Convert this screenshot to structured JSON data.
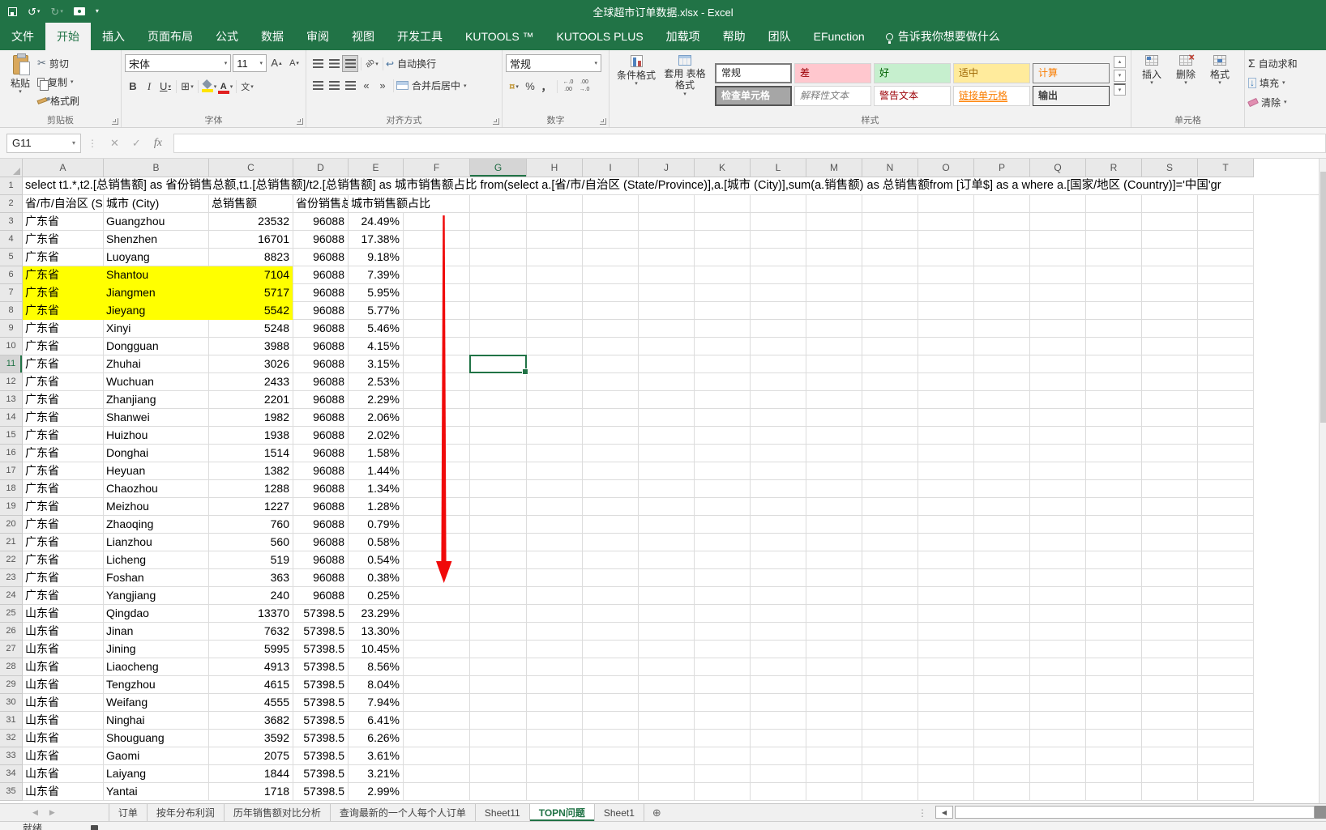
{
  "titlebar": {
    "title": "全球超市订单数据.xlsx  -  Excel"
  },
  "quick_access_icons": {
    "save": "floppy",
    "undo": "↺",
    "redo": "↻",
    "camera": "camera",
    "customize": "▾"
  },
  "ribbon_tabs": [
    {
      "label": "文件"
    },
    {
      "label": "开始",
      "active": true
    },
    {
      "label": "插入"
    },
    {
      "label": "页面布局"
    },
    {
      "label": "公式"
    },
    {
      "label": "数据"
    },
    {
      "label": "审阅"
    },
    {
      "label": "视图"
    },
    {
      "label": "开发工具"
    },
    {
      "label": "KUTOOLS ™"
    },
    {
      "label": "KUTOOLS PLUS"
    },
    {
      "label": "加载项"
    },
    {
      "label": "帮助"
    },
    {
      "label": "团队"
    },
    {
      "label": "EFunction"
    }
  ],
  "tell_me": "告诉我你想要做什么",
  "ribbon": {
    "clipboard": {
      "group": "剪贴板",
      "paste": "粘贴",
      "cut": "剪切",
      "copy": "复制",
      "format_painter": "格式刷"
    },
    "font": {
      "group": "字体",
      "family": "宋体",
      "size": "11",
      "bold": "B",
      "italic": "I",
      "underline": "U",
      "phonetic": "文"
    },
    "alignment": {
      "group": "对齐方式",
      "wrap_text": "自动换行",
      "merge_center": "合并后居中"
    },
    "number": {
      "group": "数字",
      "format": "常规",
      "percent": "%",
      "comma": "，"
    },
    "styles": {
      "group": "样式",
      "conditional_formatting": "条件格式",
      "format_as_table": "套用 表格格式",
      "cell_styles": [
        "常规",
        "差",
        "好",
        "适中",
        "计算",
        "检查单元格",
        "解释性文本",
        "警告文本",
        "链接单元格",
        "输出"
      ]
    },
    "cells": {
      "group": "单元格",
      "insert": "插入",
      "delete": "删除",
      "format": "格式"
    },
    "editing": {
      "autosum": "自动求和",
      "fill": "填充",
      "clear": "清除"
    }
  },
  "formula_bar": {
    "name_box": "G11",
    "fx": "fx"
  },
  "grid": {
    "columns": [
      "A",
      "B",
      "C",
      "D",
      "E",
      "F",
      "G",
      "H",
      "I",
      "J",
      "K",
      "L",
      "M",
      "N",
      "O",
      "P",
      "Q",
      "R",
      "S",
      "T"
    ],
    "selected": {
      "cell": "G11",
      "column": "G",
      "row": 11
    },
    "row1_text": "select t1.*,t2.[总销售额] as 省份销售总额,t1.[总销售额]/t2.[总销售额] as 城市销售额占比 from(select a.[省/市/自治区 (State/Province)],a.[城市 (City)],sum(a.销售额)  as 总销售额from [订单$] as a where  a.[国家/地区 (Country)]='中国'gr",
    "header_row": {
      "province": "省/市/自治区 (S",
      "city": "城市 (City)",
      "total": "总销售额",
      "province_total": "省份销售总",
      "share": "城市销售额占比"
    },
    "rows": [
      {
        "n": 3,
        "province": "广东省",
        "city": "Guangzhou",
        "total": "23532",
        "province_total": "96088",
        "share": "24.49%",
        "highlight": false
      },
      {
        "n": 4,
        "province": "广东省",
        "city": "Shenzhen",
        "total": "16701",
        "province_total": "96088",
        "share": "17.38%",
        "highlight": false
      },
      {
        "n": 5,
        "province": "广东省",
        "city": "Luoyang",
        "total": "8823",
        "province_total": "96088",
        "share": "9.18%",
        "highlight": false
      },
      {
        "n": 6,
        "province": "广东省",
        "city": "Shantou",
        "total": "7104",
        "province_total": "96088",
        "share": "7.39%",
        "highlight": true
      },
      {
        "n": 7,
        "province": "广东省",
        "city": "Jiangmen",
        "total": "5717",
        "province_total": "96088",
        "share": "5.95%",
        "highlight": true
      },
      {
        "n": 8,
        "province": "广东省",
        "city": "Jieyang",
        "total": "5542",
        "province_total": "96088",
        "share": "5.77%",
        "highlight": true
      },
      {
        "n": 9,
        "province": "广东省",
        "city": "Xinyi",
        "total": "5248",
        "province_total": "96088",
        "share": "5.46%",
        "highlight": false
      },
      {
        "n": 10,
        "province": "广东省",
        "city": "Dongguan",
        "total": "3988",
        "province_total": "96088",
        "share": "4.15%",
        "highlight": false
      },
      {
        "n": 11,
        "province": "广东省",
        "city": "Zhuhai",
        "total": "3026",
        "province_total": "96088",
        "share": "3.15%",
        "highlight": false
      },
      {
        "n": 12,
        "province": "广东省",
        "city": "Wuchuan",
        "total": "2433",
        "province_total": "96088",
        "share": "2.53%",
        "highlight": false
      },
      {
        "n": 13,
        "province": "广东省",
        "city": "Zhanjiang",
        "total": "2201",
        "province_total": "96088",
        "share": "2.29%",
        "highlight": false
      },
      {
        "n": 14,
        "province": "广东省",
        "city": "Shanwei",
        "total": "1982",
        "province_total": "96088",
        "share": "2.06%",
        "highlight": false
      },
      {
        "n": 15,
        "province": "广东省",
        "city": "Huizhou",
        "total": "1938",
        "province_total": "96088",
        "share": "2.02%",
        "highlight": false
      },
      {
        "n": 16,
        "province": "广东省",
        "city": "Donghai",
        "total": "1514",
        "province_total": "96088",
        "share": "1.58%",
        "highlight": false
      },
      {
        "n": 17,
        "province": "广东省",
        "city": "Heyuan",
        "total": "1382",
        "province_total": "96088",
        "share": "1.44%",
        "highlight": false
      },
      {
        "n": 18,
        "province": "广东省",
        "city": "Chaozhou",
        "total": "1288",
        "province_total": "96088",
        "share": "1.34%",
        "highlight": false
      },
      {
        "n": 19,
        "province": "广东省",
        "city": "Meizhou",
        "total": "1227",
        "province_total": "96088",
        "share": "1.28%",
        "highlight": false
      },
      {
        "n": 20,
        "province": "广东省",
        "city": "Zhaoqing",
        "total": "760",
        "province_total": "96088",
        "share": "0.79%",
        "highlight": false
      },
      {
        "n": 21,
        "province": "广东省",
        "city": "Lianzhou",
        "total": "560",
        "province_total": "96088",
        "share": "0.58%",
        "highlight": false
      },
      {
        "n": 22,
        "province": "广东省",
        "city": "Licheng",
        "total": "519",
        "province_total": "96088",
        "share": "0.54%",
        "highlight": false
      },
      {
        "n": 23,
        "province": "广东省",
        "city": "Foshan",
        "total": "363",
        "province_total": "96088",
        "share": "0.38%",
        "highlight": false
      },
      {
        "n": 24,
        "province": "广东省",
        "city": "Yangjiang",
        "total": "240",
        "province_total": "96088",
        "share": "0.25%",
        "highlight": false
      },
      {
        "n": 25,
        "province": "山东省",
        "city": "Qingdao",
        "total": "13370",
        "province_total": "57398.5",
        "share": "23.29%",
        "highlight": false
      },
      {
        "n": 26,
        "province": "山东省",
        "city": "Jinan",
        "total": "7632",
        "province_total": "57398.5",
        "share": "13.30%",
        "highlight": false
      },
      {
        "n": 27,
        "province": "山东省",
        "city": "Jining",
        "total": "5995",
        "province_total": "57398.5",
        "share": "10.45%",
        "highlight": false
      },
      {
        "n": 28,
        "province": "山东省",
        "city": "Liaocheng",
        "total": "4913",
        "province_total": "57398.5",
        "share": "8.56%",
        "highlight": false
      },
      {
        "n": 29,
        "province": "山东省",
        "city": "Tengzhou",
        "total": "4615",
        "province_total": "57398.5",
        "share": "8.04%",
        "highlight": false
      },
      {
        "n": 30,
        "province": "山东省",
        "city": "Weifang",
        "total": "4555",
        "province_total": "57398.5",
        "share": "7.94%",
        "highlight": false
      },
      {
        "n": 31,
        "province": "山东省",
        "city": "Ninghai",
        "total": "3682",
        "province_total": "57398.5",
        "share": "6.41%",
        "highlight": false
      },
      {
        "n": 32,
        "province": "山东省",
        "city": "Shouguang",
        "total": "3592",
        "province_total": "57398.5",
        "share": "6.26%",
        "highlight": false
      },
      {
        "n": 33,
        "province": "山东省",
        "city": "Gaomi",
        "total": "2075",
        "province_total": "57398.5",
        "share": "3.61%",
        "highlight": false
      },
      {
        "n": 34,
        "province": "山东省",
        "city": "Laiyang",
        "total": "1844",
        "province_total": "57398.5",
        "share": "3.21%",
        "highlight": false
      },
      {
        "n": 35,
        "province": "山东省",
        "city": "Yantai",
        "total": "1718",
        "province_total": "57398.5",
        "share": "2.99%",
        "highlight": false
      }
    ]
  },
  "sheet_tabs": [
    {
      "label": "订单"
    },
    {
      "label": "按年分布利润"
    },
    {
      "label": "历年销售额对比分析"
    },
    {
      "label": "查询最新的一个人每个人订单"
    },
    {
      "label": "Sheet11"
    },
    {
      "label": "TOPN问题",
      "active": true
    },
    {
      "label": "Sheet1"
    }
  ],
  "status_bar": {
    "ready": "就绪"
  },
  "colors": {
    "excel_green": "#217346",
    "highlight_yellow": "#ffff00",
    "arrow_red": "#f00a0a",
    "style_bad_bg": "#ffc7ce",
    "style_good_bg": "#c6efce",
    "style_neutral_bg": "#ffeb9c",
    "style_calc_text": "#fa7d00",
    "style_check_bg": "#a6a6a6"
  }
}
